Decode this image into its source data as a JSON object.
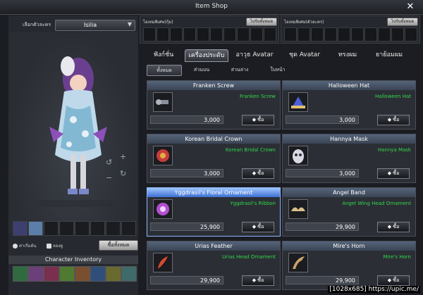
{
  "window": {
    "title": "Item Shop",
    "close_symbol": "✕"
  },
  "character": {
    "select_label": "เลือกตัวละคร",
    "selected": "Isilia",
    "preview_rotation": [
      "↺",
      "+",
      "↻",
      "−"
    ]
  },
  "options": {
    "reset_label": "ค่าเริ่มต้น",
    "try_label": "ลองดู",
    "buy_all_label": "ซื้อทั้งหมด"
  },
  "inventory": {
    "title": "Character Inventory"
  },
  "bundles": [
    {
      "label": "ไอเทมพิเศษ(กุ้ม)",
      "button": "ไปรับทั้งหมด"
    },
    {
      "label": "ไอเทมพิเศษ(ตัวละคร)",
      "button": "ไปรับทั้งหมด"
    }
  ],
  "tabs": [
    "ฟังก์ชั่น",
    "เครื่องประดับ",
    "อาวุธ Avatar",
    "ชุด Avatar",
    "ทรงผม",
    "ยาย้อมผม"
  ],
  "active_tab": 1,
  "subtabs": [
    "ทั้งหมด",
    "ส่วนบน",
    "ส่วนล่าง",
    "ใบหน้า"
  ],
  "active_subtab": 0,
  "items": [
    {
      "name": "Franken Screw",
      "desc": "Franken Screw",
      "price": "3,000",
      "buy": "ซื้อ",
      "icon": "screw-icon",
      "color": "#8a8f9a"
    },
    {
      "name": "Halloween Hat",
      "desc": "Halloween Hat",
      "price": "3,000",
      "buy": "ซื้อ",
      "icon": "hat-icon",
      "color": "#4a5fd8"
    },
    {
      "name": "Korean Bridal Crown",
      "desc": "Korean Bridal Crown",
      "price": "3,000",
      "buy": "ซื้อ",
      "icon": "crown-icon",
      "color": "#c63b3b"
    },
    {
      "name": "Hannya Mask",
      "desc": "Hannya Mask",
      "price": "3,000",
      "buy": "ซื้อ",
      "icon": "mask-icon",
      "color": "#d9d9e6"
    },
    {
      "name": "Yggdrasil's Floral Ornament",
      "desc": "Yggdrasil's Ribbon",
      "price": "25,900",
      "buy": "ซื้อ",
      "icon": "flower-icon",
      "color": "#b24fd0"
    },
    {
      "name": "Angel Band",
      "desc": "Angel Wing Head Ornament",
      "price": "29,900",
      "buy": "ซื้อ",
      "icon": "wing-band-icon",
      "color": "#d8c08a"
    },
    {
      "name": "Urias Feather",
      "desc": "Urias Head Ornament",
      "price": "29,900",
      "buy": "ซื้อ",
      "icon": "feather-icon",
      "color": "#d84a2e"
    },
    {
      "name": "Mire's Horn",
      "desc": "Mire's Horn",
      "price": "29,900",
      "buy": "ซื้อ",
      "icon": "horn-icon",
      "color": "#c9a36a"
    }
  ],
  "selected_item": 4,
  "watermark": "[1028x685] https://upic.me/"
}
